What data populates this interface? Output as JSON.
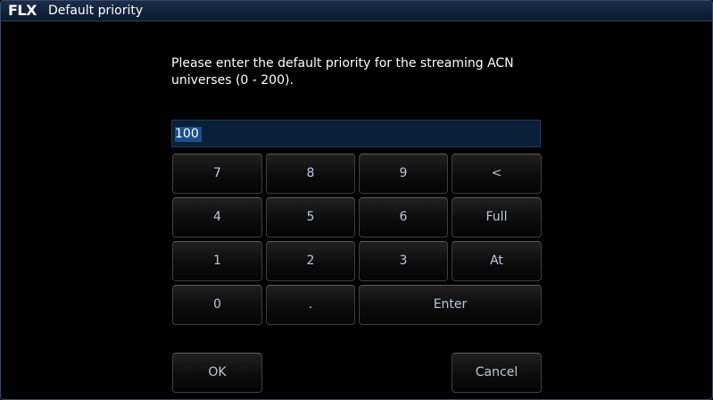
{
  "window": {
    "logo": "FLX",
    "title": "Default priority"
  },
  "prompt": {
    "text": "Please enter the default priority for the streaming ACN\nuniverses (0 - 200)."
  },
  "entry": {
    "value": "100"
  },
  "keypad": {
    "k7": "7",
    "k8": "8",
    "k9": "9",
    "backspace": "<",
    "k4": "4",
    "k5": "5",
    "k6": "6",
    "full": "Full",
    "k1": "1",
    "k2": "2",
    "k3": "3",
    "at": "At",
    "k0": "0",
    "dot": ".",
    "enter": "Enter"
  },
  "buttons": {
    "ok": "OK",
    "cancel": "Cancel"
  }
}
